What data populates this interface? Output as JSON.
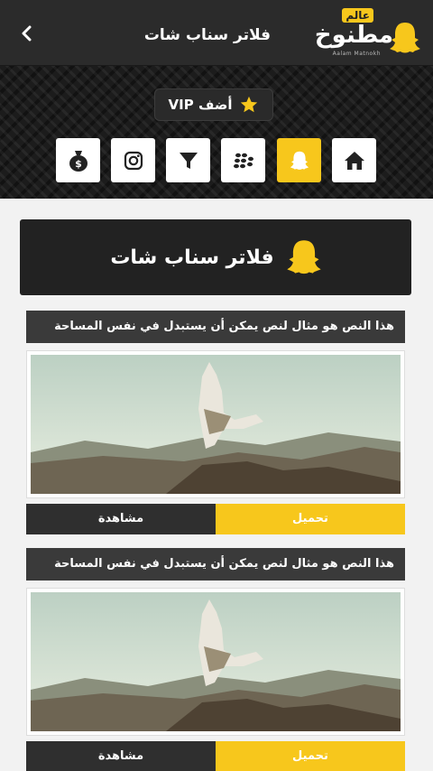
{
  "header": {
    "title": "فلاتر سناب شات",
    "logo": {
      "word": "مطنوخ",
      "small": "عالم",
      "sub": "Aalam Matnokh"
    },
    "back_icon": "chevron-left-icon"
  },
  "hero": {
    "vip_label": "أضف VIP",
    "vip_icon": "star-icon",
    "nav": [
      {
        "name": "home",
        "icon": "home-icon",
        "active": false
      },
      {
        "name": "snapchat",
        "icon": "snapchat-ghost-icon",
        "active": true
      },
      {
        "name": "blackberry",
        "icon": "blackberry-icon",
        "active": false
      },
      {
        "name": "filter",
        "icon": "filter-icon",
        "active": false
      },
      {
        "name": "instagram",
        "icon": "instagram-icon",
        "active": false
      },
      {
        "name": "money",
        "icon": "money-bag-icon",
        "active": false
      }
    ]
  },
  "section": {
    "title": "فلاتر سناب شات",
    "icon": "snapchat-ghost-icon"
  },
  "cards": [
    {
      "caption": "هذا النص هو مثال لنص يمكن أن يستبدل في نفس المساحة",
      "download_label": "تحميل",
      "view_label": "مشاهدة"
    },
    {
      "caption": "هذا النص هو مثال لنص يمكن أن يستبدل في نفس المساحة",
      "download_label": "تحميل",
      "view_label": "مشاهدة"
    }
  ],
  "colors": {
    "accent": "#f7c71c",
    "dark": "#2b2b2b",
    "caption_bg": "#3a3a3a"
  }
}
